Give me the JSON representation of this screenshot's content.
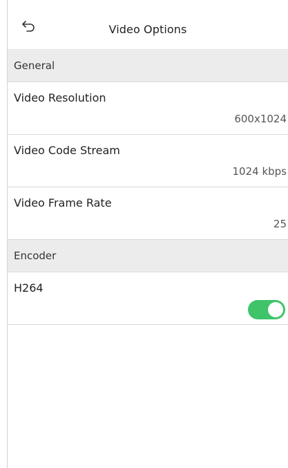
{
  "header": {
    "title": "Video Options",
    "back_icon": "back-arrow-icon"
  },
  "sections": {
    "general": {
      "label": "General",
      "items": [
        {
          "label": "Video Resolution",
          "value": "600x1024"
        },
        {
          "label": "Video Code Stream",
          "value": "1024 kbps"
        },
        {
          "label": "Video Frame Rate",
          "value": "25"
        }
      ]
    },
    "encoder": {
      "label": "Encoder",
      "items": [
        {
          "label": "H264",
          "toggle_on": true
        }
      ]
    }
  },
  "colors": {
    "section_bg": "#ececec",
    "toggle_on": "#3fc46a"
  }
}
